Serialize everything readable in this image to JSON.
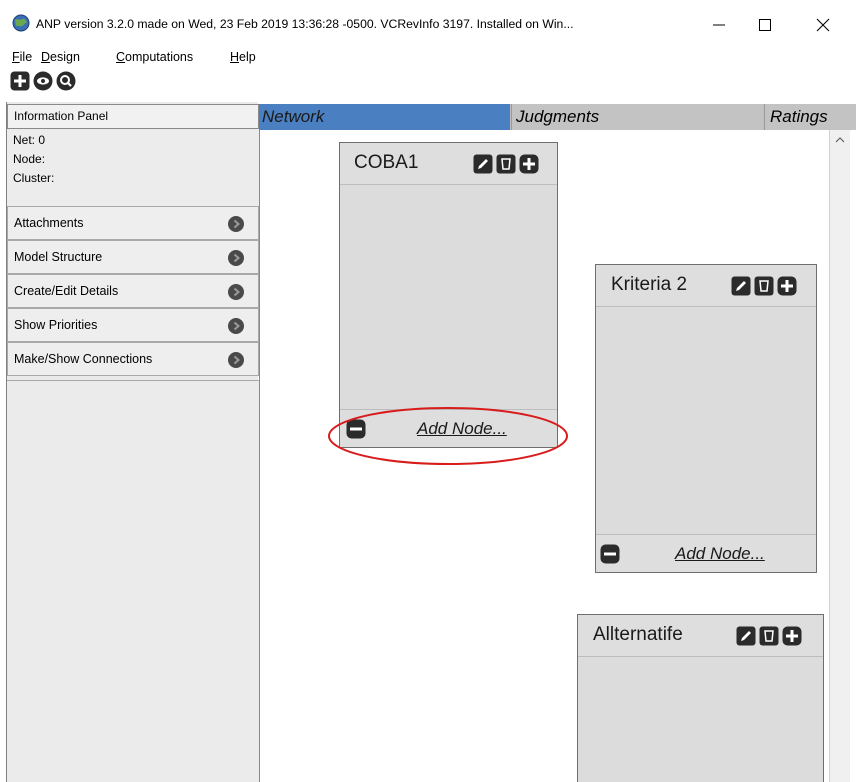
{
  "window": {
    "title": "ANP version 3.2.0 made on Wed, 23 Feb 2019 13:36:28 -0500.  VCRevInfo 3197.  Installed on Win...",
    "icon": "globe-icon",
    "controls": [
      "minimize-icon",
      "maximize-icon",
      "close-icon"
    ]
  },
  "menu": {
    "items": [
      {
        "key": "F",
        "rest": "ile"
      },
      {
        "key": "D",
        "rest": "esign"
      },
      {
        "key": "C",
        "rest": "omputations"
      },
      {
        "key": "H",
        "rest": "elp"
      }
    ]
  },
  "toolbar": {
    "icons": [
      "add-icon",
      "eye-icon",
      "zoom-icon"
    ]
  },
  "info_panel": {
    "title": "Information Panel",
    "net_label": "Net: 0",
    "node_label": "Node:",
    "cluster_label": "Cluster:"
  },
  "accordion": [
    {
      "label": "Attachments"
    },
    {
      "label": "Model Structure"
    },
    {
      "label": "Create/Edit Details"
    },
    {
      "label": "Show Priorities"
    },
    {
      "label": "Make/Show Connections"
    }
  ],
  "tabs": {
    "network": "Network",
    "judgments": "Judgments",
    "ratings": "Ratings"
  },
  "clusters": [
    {
      "name": "COBA1",
      "add_node": "Add Node..."
    },
    {
      "name": "Kriteria 2",
      "add_node": "Add Node..."
    },
    {
      "name": "Allternatife",
      "add_node": ""
    }
  ],
  "colors": {
    "tab_active": "#4a7fc1",
    "highlight": "#d81c1c",
    "button_dark": "#2b2b2b"
  }
}
